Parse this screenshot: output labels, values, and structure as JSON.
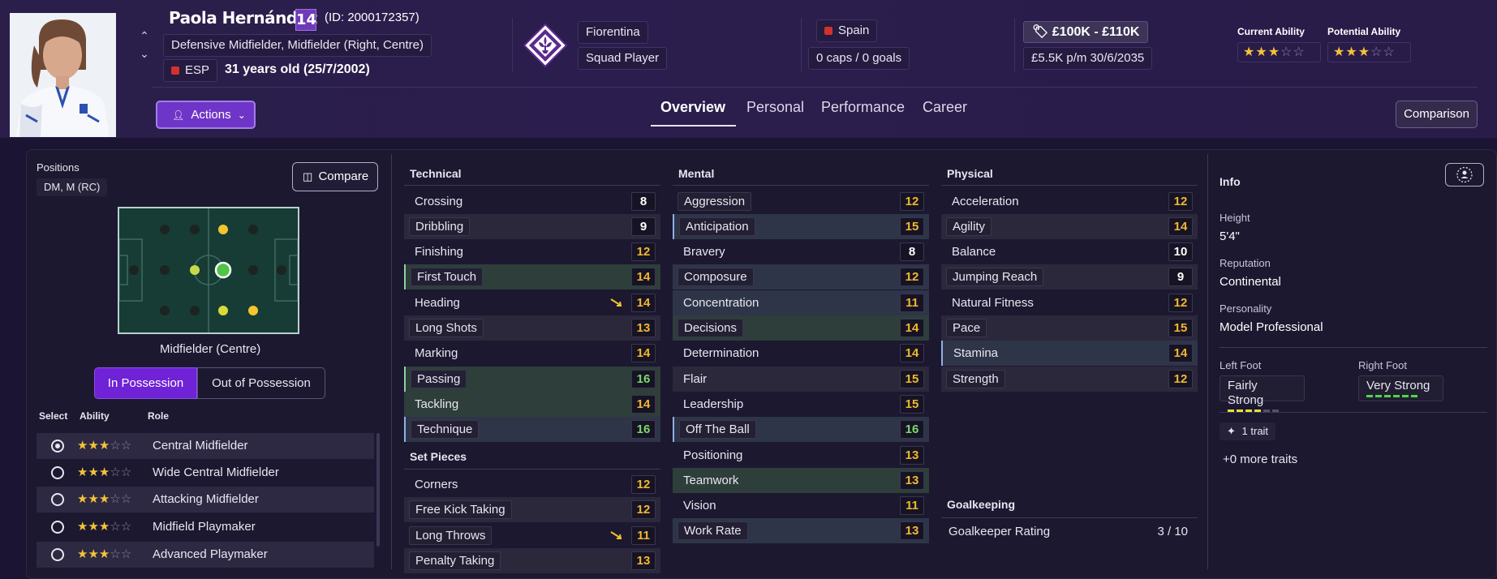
{
  "player": {
    "name": "Paola Hernández",
    "number": "14",
    "id_text": "(ID: 2000172357)",
    "positions_text": "Defensive Midfielder, Midfielder (Right, Centre)",
    "nationality_code": "ESP",
    "age_text": "31 years old (25/7/2002)"
  },
  "club": {
    "name": "Fiorentina",
    "status": "Squad Player"
  },
  "nation": {
    "name": "Spain",
    "caps": "0 caps / 0 goals"
  },
  "contract": {
    "value": "£100K - £110K",
    "wage": "£5.5K p/m 30/6/2035"
  },
  "ability": {
    "current_label": "Current Ability",
    "current_stars": 3,
    "current_text": "★★★☆☆",
    "potential_label": "Potential Ability",
    "potential_stars": 3,
    "potential_text": "★★★☆☆"
  },
  "actions_label": "Actions",
  "tabs": [
    "Overview",
    "Personal",
    "Performance",
    "Career"
  ],
  "comparison_label": "Comparison",
  "positions": {
    "label": "Positions",
    "value": "DM, M (RC)",
    "compare_label": "Compare",
    "pitch_label": "Midfielder (Centre)",
    "in_possession": "In Possession",
    "out_possession": "Out of Possession"
  },
  "roles": {
    "headers": {
      "select": "Select",
      "ability": "Ability",
      "role": "Role"
    },
    "items": [
      {
        "name": "Central Midfielder",
        "stars": "★★★☆☆",
        "selected": true
      },
      {
        "name": "Wide Central Midfielder",
        "stars": "★★★☆☆",
        "selected": false
      },
      {
        "name": "Attacking Midfielder",
        "stars": "★★★☆☆",
        "selected": false
      },
      {
        "name": "Midfield Playmaker",
        "stars": "★★★☆☆",
        "selected": false
      },
      {
        "name": "Advanced Playmaker",
        "stars": "★★★☆☆",
        "selected": false
      }
    ]
  },
  "technical": {
    "title": "Technical",
    "items": [
      {
        "name": "Crossing",
        "value": "8"
      },
      {
        "name": "Dribbling",
        "value": "9"
      },
      {
        "name": "Finishing",
        "value": "12"
      },
      {
        "name": "First Touch",
        "value": "14"
      },
      {
        "name": "Heading",
        "value": "14",
        "trend": "down"
      },
      {
        "name": "Long Shots",
        "value": "13"
      },
      {
        "name": "Marking",
        "value": "14"
      },
      {
        "name": "Passing",
        "value": "16"
      },
      {
        "name": "Tackling",
        "value": "14"
      },
      {
        "name": "Technique",
        "value": "16"
      }
    ]
  },
  "set_pieces": {
    "title": "Set Pieces",
    "items": [
      {
        "name": "Corners",
        "value": "12"
      },
      {
        "name": "Free Kick Taking",
        "value": "12"
      },
      {
        "name": "Long Throws",
        "value": "11",
        "trend": "down"
      },
      {
        "name": "Penalty Taking",
        "value": "13"
      }
    ]
  },
  "mental": {
    "title": "Mental",
    "items": [
      {
        "name": "Aggression",
        "value": "12"
      },
      {
        "name": "Anticipation",
        "value": "15"
      },
      {
        "name": "Bravery",
        "value": "8"
      },
      {
        "name": "Composure",
        "value": "12"
      },
      {
        "name": "Concentration",
        "value": "11"
      },
      {
        "name": "Decisions",
        "value": "14"
      },
      {
        "name": "Determination",
        "value": "14"
      },
      {
        "name": "Flair",
        "value": "15"
      },
      {
        "name": "Leadership",
        "value": "15"
      },
      {
        "name": "Off The Ball",
        "value": "16"
      },
      {
        "name": "Positioning",
        "value": "13"
      },
      {
        "name": "Teamwork",
        "value": "13"
      },
      {
        "name": "Vision",
        "value": "11"
      },
      {
        "name": "Work Rate",
        "value": "13"
      }
    ]
  },
  "physical": {
    "title": "Physical",
    "items": [
      {
        "name": "Acceleration",
        "value": "12"
      },
      {
        "name": "Agility",
        "value": "14"
      },
      {
        "name": "Balance",
        "value": "10"
      },
      {
        "name": "Jumping Reach",
        "value": "9"
      },
      {
        "name": "Natural Fitness",
        "value": "12"
      },
      {
        "name": "Pace",
        "value": "15"
      },
      {
        "name": "Stamina",
        "value": "14"
      },
      {
        "name": "Strength",
        "value": "12"
      }
    ]
  },
  "goalkeeping": {
    "title": "Goalkeeping",
    "label": "Goalkeeper Rating",
    "value": "3 / 10"
  },
  "info": {
    "title": "Info",
    "height_label": "Height",
    "height": "5'4\"",
    "reputation_label": "Reputation",
    "reputation": "Continental",
    "personality_label": "Personality",
    "personality": "Model Professional",
    "left_foot_label": "Left Foot",
    "left_foot": "Fairly Strong",
    "left_foot_level": 4,
    "right_foot_label": "Right Foot",
    "right_foot": "Very Strong",
    "right_foot_level": 6,
    "trait_chip": "1 trait",
    "more_traits": "+0 more traits"
  },
  "colors": {
    "accent": "#6f35c8",
    "yellow": "#f3b630",
    "green": "#7dd86d",
    "star": "#f4c23a"
  }
}
